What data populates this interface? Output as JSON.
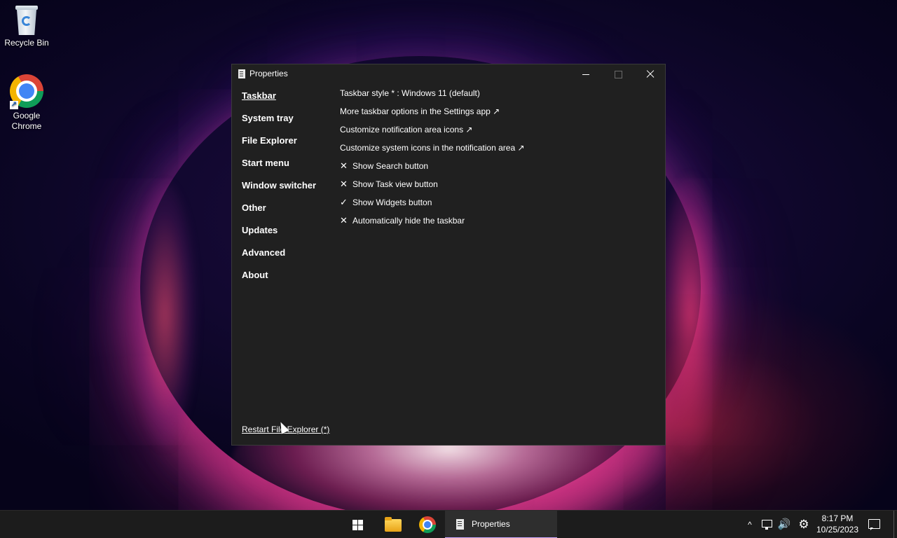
{
  "desktop": {
    "icons": [
      {
        "label": "Recycle Bin",
        "icon": "recycle-bin-icon"
      },
      {
        "label": "Google Chrome",
        "icon": "chrome-icon",
        "shortcut": true
      }
    ]
  },
  "window": {
    "title": "Properties",
    "nav": [
      {
        "label": "Taskbar",
        "active": true
      },
      {
        "label": "System tray"
      },
      {
        "label": "File Explorer"
      },
      {
        "label": "Start menu"
      },
      {
        "label": "Window switcher"
      },
      {
        "label": "Other"
      },
      {
        "label": "Updates"
      },
      {
        "label": "Advanced"
      },
      {
        "label": "About"
      }
    ],
    "settings": [
      {
        "label": "Taskbar style * : Windows 11 (default)"
      },
      {
        "label": "More taskbar options in the Settings app ↗"
      },
      {
        "label": "Customize notification area icons ↗"
      },
      {
        "label": "Customize system icons in the notification area ↗"
      },
      {
        "label": "Show Search button",
        "mark": "✕"
      },
      {
        "label": "Show Task view button",
        "mark": "✕"
      },
      {
        "label": "Show Widgets button",
        "mark": "✓"
      },
      {
        "label": "Automatically hide the taskbar",
        "mark": "✕"
      }
    ],
    "restart_link": "Restart File Explorer (*)"
  },
  "taskbar": {
    "apps": [
      {
        "name": "start-button",
        "icon": "windows-logo-icon"
      },
      {
        "name": "file-explorer",
        "icon": "folder-icon"
      },
      {
        "name": "google-chrome",
        "icon": "chrome-icon"
      },
      {
        "name": "properties",
        "icon": "properties-icon",
        "label": "Properties",
        "active": true
      }
    ],
    "tray": {
      "chevron": "^",
      "volume": "🔊",
      "settings": "⚙",
      "time": "8:17 PM",
      "date": "10/25/2023"
    }
  },
  "colors": {
    "window_bg": "#202020",
    "taskbar_bg": "#1c1c1c",
    "active_underline": "#c9a6ff"
  }
}
